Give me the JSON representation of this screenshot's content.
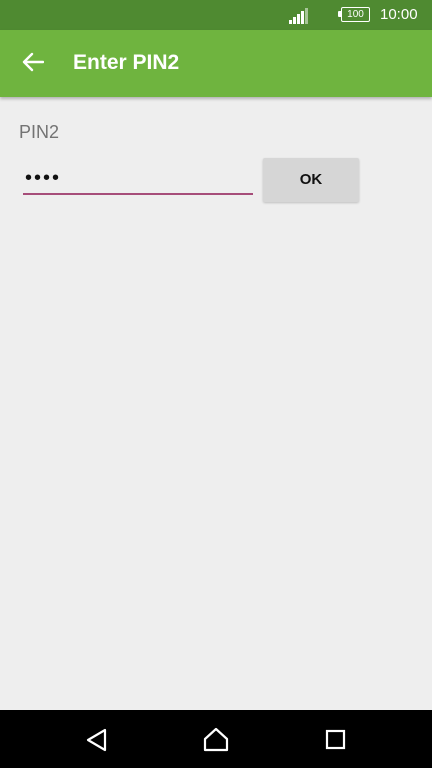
{
  "status_bar": {
    "battery_level": "100",
    "time": "10:00",
    "icons": [
      "signal-icon",
      "battery-icon"
    ]
  },
  "app_bar": {
    "title": "Enter PIN2",
    "back_icon": "arrow-back-icon",
    "color": "#6fb43f"
  },
  "form": {
    "label": "PIN2",
    "pin_value": "••••",
    "ok_label": "OK",
    "underline_color": "#a64d79"
  },
  "nav_bar": {
    "icons": [
      "nav-back-icon",
      "nav-home-icon",
      "nav-recent-icon"
    ]
  }
}
